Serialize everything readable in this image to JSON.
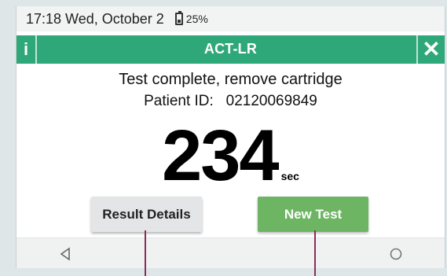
{
  "status_bar": {
    "time_date": "17:18 Wed, October 2",
    "battery_percent": "25%",
    "battery_level": 25
  },
  "title_bar": {
    "title": "ACT-LR",
    "info_symbol": "i",
    "close_symbol": "✕",
    "accent_color": "#2fa879"
  },
  "result": {
    "message": "Test complete, remove cartridge",
    "patient_line": "Patient ID:   02120069849",
    "value": "234",
    "unit": "sec"
  },
  "buttons": {
    "result_details_label": "Result Details",
    "new_test_label": "New Test",
    "new_test_color": "#6db563"
  },
  "nav": {
    "back_icon": "triangle-back-icon",
    "home_icon": "circle-home-icon"
  },
  "annotation_color": "#8b2d5a"
}
